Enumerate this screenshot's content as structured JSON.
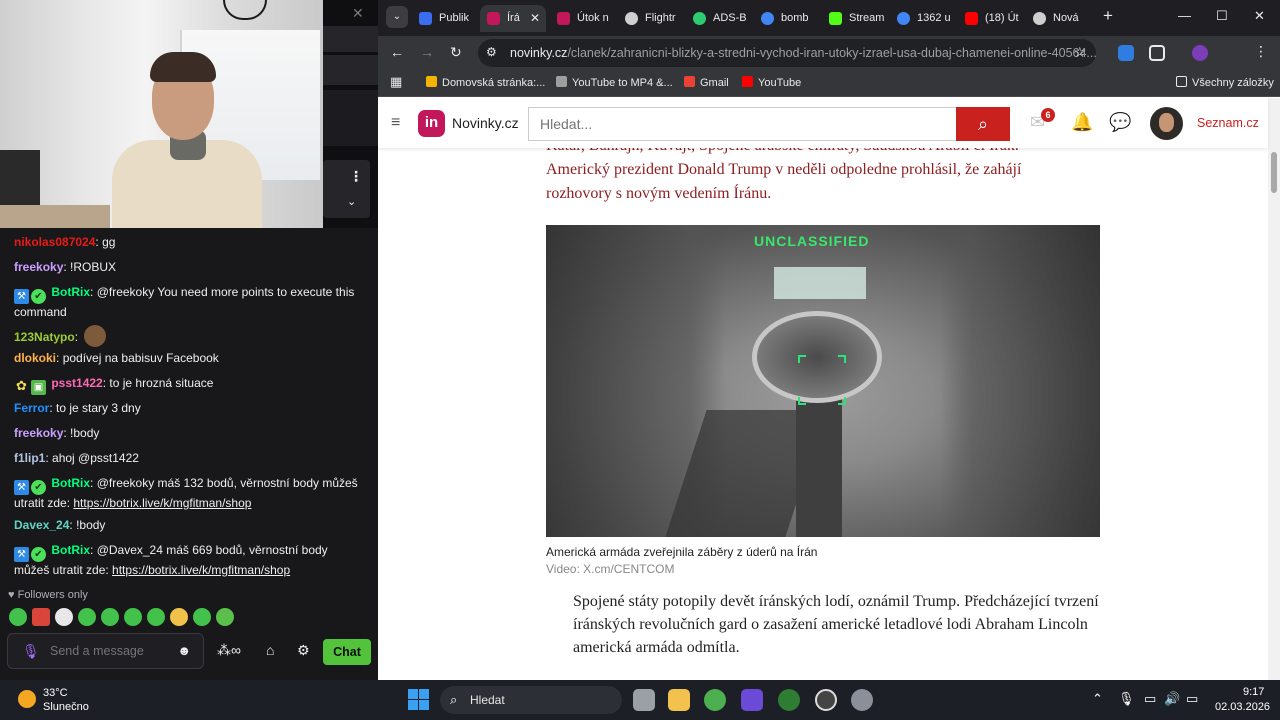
{
  "chat": {
    "messages": [
      {
        "user": "nikolas087024",
        "color": "#e91916",
        "text": "gg"
      },
      {
        "user": "freekoky",
        "color": "#c9a0ff",
        "text": "!ROBUX"
      },
      {
        "user": "BotRix",
        "color": "#00ff7f",
        "text": "@freekoky You need more points to execute this command"
      },
      {
        "user": "123Natypo",
        "color": "#9acd32",
        "text": ""
      },
      {
        "user": "dlokoki",
        "color": "#ffb347",
        "text": "podívej na babisuv Facebook"
      },
      {
        "user": "psst1422",
        "color": "#ff69b4",
        "text": "to je hrozná situace"
      },
      {
        "user": "Ferror",
        "color": "#1e90ff",
        "text": "to je stary 3 dny"
      },
      {
        "user": "freekoky",
        "color": "#c9a0ff",
        "text": "!body"
      },
      {
        "user": "f1lip1",
        "color": "#b0c4de",
        "text": "ahoj @psst1422"
      },
      {
        "user": "BotRix",
        "color": "#00ff7f",
        "text": "@freekoky máš 132 bodů, věrnostní body můžeš utratit zde: ",
        "link": "https://botrix.live/k/mgfitman/shop"
      },
      {
        "user": "Davex_24",
        "color": "#5fd4c3",
        "text": "!body"
      },
      {
        "user": "BotRix",
        "color": "#00ff7f",
        "text": "@Davex_24 máš 669 bodů, věrnostní body můžeš utratit zde: ",
        "link": "https://botrix.live/k/mgfitman/shop"
      }
    ],
    "followers_only": "Followers only",
    "input_placeholder": "Send a message",
    "chat_button": "Chat"
  },
  "browser": {
    "tabs": [
      {
        "label": "Publik",
        "color": "#3a6df0"
      },
      {
        "label": "Írá",
        "color": "#c2185b",
        "active": true
      },
      {
        "label": "Útok n",
        "color": "#c2185b"
      },
      {
        "label": "Flightr",
        "color": "#cfcfcf"
      },
      {
        "label": "ADS-B",
        "color": "#2ecc71"
      },
      {
        "label": "bomb",
        "color": "#4285f4"
      },
      {
        "label": "Stream",
        "color": "#53fc18"
      },
      {
        "label": "1362 u",
        "color": "#4285f4"
      },
      {
        "label": "(18) Út",
        "color": "#ff0000"
      },
      {
        "label": "Nová",
        "color": "#cfcfcf"
      }
    ],
    "url_domain": "novinky.cz",
    "url_path": "/clanek/zahranicni-blizky-a-stredni-vychod-iran-utoky-izrael-usa-dubaj-chamenei-online-40564...",
    "bookmarks": [
      {
        "label": "Domovská stránka:...",
        "color": "#f4b400"
      },
      {
        "label": "YouTube to MP4 &...",
        "color": "#9e9e9e"
      },
      {
        "label": "Gmail",
        "color": "#ea4335"
      },
      {
        "label": "YouTube",
        "color": "#ff0000"
      }
    ],
    "all_bookmarks": "Všechny záložky"
  },
  "site": {
    "logo": "in",
    "name": "Novinky.cz",
    "search_placeholder": "Hledat...",
    "mail_count": "6",
    "seznam": "Seznam.cz"
  },
  "article": {
    "lead_line1": "Katar, Bahrajn, Kuvajt, Spojené arabské emiráty, Saúdskou Arábii či Irák.",
    "lead_line2": "Americký prezident Donald Trump v neděli odpoledne prohlásil, že zahájí rozhovory s novým vedením Íránu.",
    "image_label": "UNCLASSIFIED",
    "caption": "Americká armáda zveřejnila záběry z úderů na Írán",
    "credit": "Video: X.cm/CENTCOM",
    "body": "Spojené státy potopily devět íránských lodí, oznámil Trump. Předcházející tvrzení íránských revolučních gard o zasažení americké letadlové lodi Abraham Lincoln americká armáda odmítla."
  },
  "taskbar": {
    "temp": "33°C",
    "weather": "Slunečno",
    "search": "Hledat",
    "time": "9:17",
    "date": "02.03.2026"
  }
}
